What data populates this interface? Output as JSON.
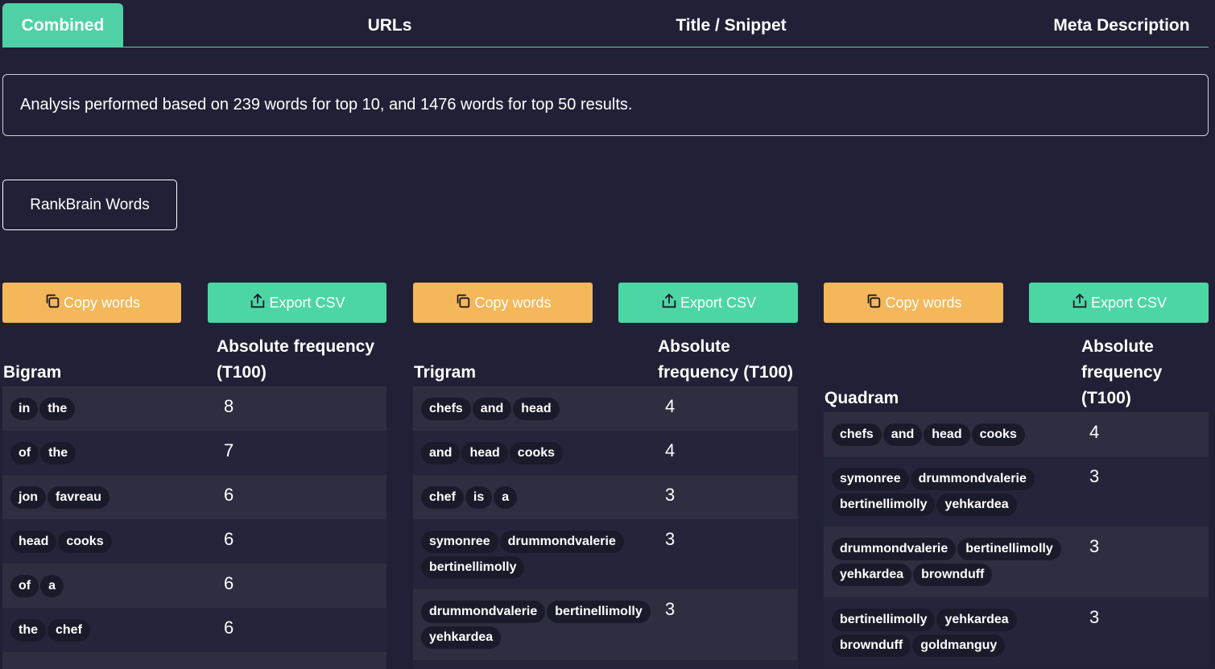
{
  "tabs": [
    "Combined",
    "URLs",
    "Title / Snippet",
    "Meta Description"
  ],
  "info_text": "Analysis performed based on 239 words for top 10, and 1476 words for top 50 results.",
  "rankbrain_label": "RankBrain Words",
  "copy_label": "Copy words",
  "export_label": "Export CSV",
  "colors": {
    "accent": "#4fd1a5",
    "copy": "#f4b75a",
    "export": "#4cd6a4",
    "background": "#222036"
  },
  "tables": [
    {
      "title": "Bigram",
      "freq_header_lines": [
        "Absolute frequency",
        "(T100)"
      ],
      "rows": [
        {
          "words": [
            "in",
            "the"
          ],
          "freq": "8"
        },
        {
          "words": [
            "of",
            "the"
          ],
          "freq": "7"
        },
        {
          "words": [
            "jon",
            "favreau"
          ],
          "freq": "6"
        },
        {
          "words": [
            "head",
            "cooks"
          ],
          "freq": "6"
        },
        {
          "words": [
            "of",
            "a"
          ],
          "freq": "6"
        },
        {
          "words": [
            "the",
            "chef"
          ],
          "freq": "6"
        }
      ]
    },
    {
      "title": "Trigram",
      "freq_header_lines": [
        "Absolute",
        "frequency (T100)"
      ],
      "rows": [
        {
          "words": [
            "chefs",
            "and",
            "head"
          ],
          "freq": "4"
        },
        {
          "words": [
            "and",
            "head",
            "cooks"
          ],
          "freq": "4"
        },
        {
          "words": [
            "chef",
            "is",
            "a"
          ],
          "freq": "3"
        },
        {
          "words": [
            "symonree",
            "drummondvalerie",
            "bertinellimolly"
          ],
          "freq": "3"
        },
        {
          "words": [
            "drummondvalerie",
            "bertinellimolly",
            "yehkardea"
          ],
          "freq": "3"
        }
      ]
    },
    {
      "title": "Quadram",
      "freq_header_lines": [
        "Absolute",
        "frequency",
        "(T100)"
      ],
      "rows": [
        {
          "words": [
            "chefs",
            "and",
            "head",
            "cooks"
          ],
          "freq": "4"
        },
        {
          "words": [
            "symonree",
            "drummondvalerie",
            "bertinellimolly",
            "yehkardea"
          ],
          "freq": "3"
        },
        {
          "words": [
            "drummondvalerie",
            "bertinellimolly",
            "yehkardea",
            "brownduff"
          ],
          "freq": "3"
        },
        {
          "words": [
            "bertinellimolly",
            "yehkardea",
            "brownduff",
            "goldmanguy"
          ],
          "freq": "3"
        }
      ]
    }
  ]
}
